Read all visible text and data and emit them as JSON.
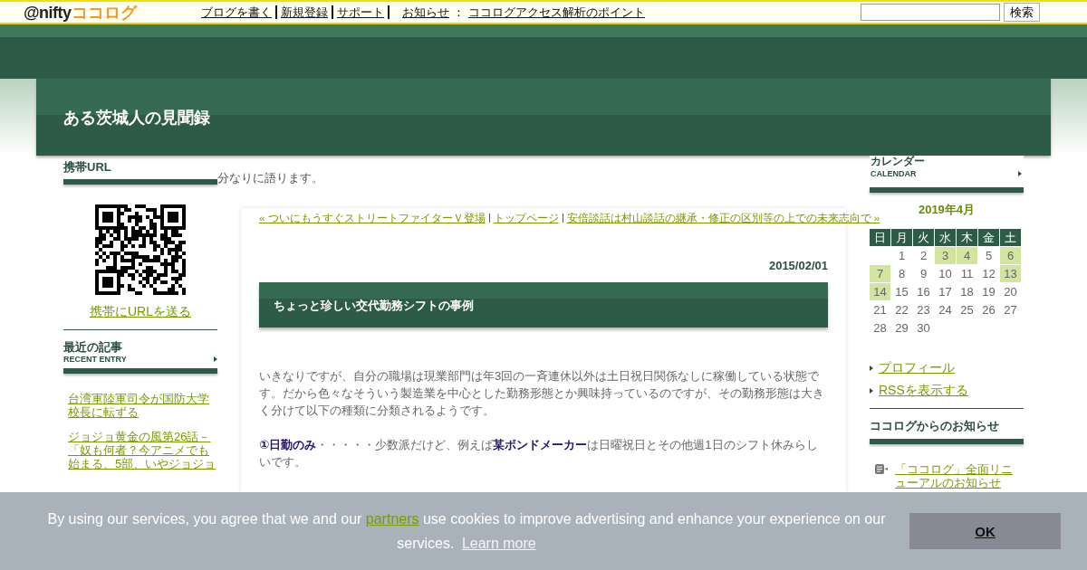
{
  "topbar": {
    "logo_at": "@nifty",
    "logo_brand": "ココログ",
    "links": [
      {
        "label": "ブログを書く"
      },
      {
        "label": "新規登録"
      },
      {
        "label": "サポート"
      }
    ],
    "notice_label": "お知らせ",
    "notice_sep": "：",
    "notice_link": "ココログアクセス解析のポイント",
    "search_button": "検索"
  },
  "blog": {
    "title": "ある茨城人の見聞録",
    "tagline": "分なりに語ります。"
  },
  "left": {
    "mobile_heading": "携帯URL",
    "send_link": "携帯にURLを送る",
    "recent_heading": "最近の記事",
    "recent_sub": "RECENT ENTRY",
    "recent": [
      "台湾軍陸軍司令が国防大学校長に転ずる",
      "ジョジョ黄金の風第26話－「奴も何者？今アニメでも始まる、5部、いやジョジョ"
    ]
  },
  "main": {
    "prev": "« ついにもうすぐストリートファイターＶ登場",
    "top": "トップページ",
    "next": "安倍談話は村山談話の継承・修正の区別等の上での未来志向で »",
    "date": "2015/02/01",
    "title": "ちょっと珍しい交代勤務シフトの事例",
    "paragraphs": [
      "いきなりですが、自分の職場は現業部門は年3回の一斉連休以外は土日祝日関係なしに稼働している状態です。だから色々なそういう製造業を中心とした勤務形態とか興味持っているのですが、その勤務形態は大きく分けて以下の種類に分類されるようです。",
      "**①日勤のみ**・・・・・少数派だけど、例えば**某ボンドメーカー**は日曜祝日とその他週1日のシフト休みらしいです。"
    ]
  },
  "right": {
    "calendar_heading": "カレンダー",
    "calendar_sub": "CALENDAR",
    "month": "2019年4月",
    "weekdays": [
      "日",
      "月",
      "火",
      "水",
      "木",
      "金",
      "土"
    ],
    "weeks": [
      [
        {
          "day": "1",
          "linked": false
        },
        {
          "day": "2",
          "linked": false
        },
        {
          "day": "3",
          "linked": true
        },
        {
          "day": "4",
          "linked": true
        },
        {
          "day": "5",
          "linked": false
        },
        {
          "day": "6",
          "linked": true
        }
      ],
      [
        {
          "day": "7",
          "linked": true
        },
        {
          "day": "8",
          "linked": false
        },
        {
          "day": "9",
          "linked": false
        },
        {
          "day": "10",
          "linked": false
        },
        {
          "day": "11",
          "linked": false
        },
        {
          "day": "12",
          "linked": false
        },
        {
          "day": "13",
          "linked": true
        }
      ],
      [
        {
          "day": "14",
          "linked": true
        },
        {
          "day": "15",
          "linked": false
        },
        {
          "day": "16",
          "linked": false
        },
        {
          "day": "17",
          "linked": false
        },
        {
          "day": "18",
          "linked": false
        },
        {
          "day": "19",
          "linked": false
        },
        {
          "day": "20",
          "linked": false
        }
      ],
      [
        {
          "day": "21",
          "linked": false
        },
        {
          "day": "22",
          "linked": false
        },
        {
          "day": "23",
          "linked": false
        },
        {
          "day": "24",
          "linked": false
        },
        {
          "day": "25",
          "linked": false
        },
        {
          "day": "26",
          "linked": false
        },
        {
          "day": "27",
          "linked": false
        }
      ],
      [
        {
          "day": "28",
          "linked": false
        },
        {
          "day": "29",
          "linked": false
        },
        {
          "day": "30",
          "linked": false
        }
      ]
    ],
    "links": [
      "プロフィール",
      "RSSを表示する"
    ],
    "notices_heading": "ココログからのお知らせ",
    "notices": [
      "「ココログ」全面リニューアルのお知らせ"
    ]
  },
  "cookie": {
    "before": "By using our services, you agree that we and our",
    "link": "partners",
    "after": "use cookies to improve advertising and enhance your experience on our services.",
    "learn": "Learn more",
    "button": "OK"
  }
}
